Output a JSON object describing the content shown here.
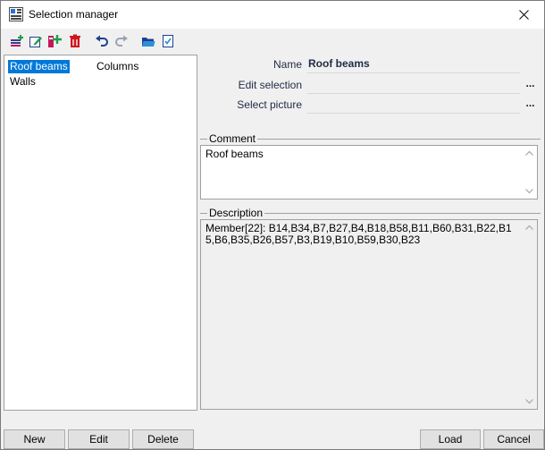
{
  "window": {
    "title": "Selection manager"
  },
  "list": {
    "items": [
      "Roof beams",
      "Columns",
      "Walls"
    ],
    "selected": "Roof beams"
  },
  "properties": {
    "name_label": "Name",
    "name_value": "Roof beams",
    "edit_selection_label": "Edit selection",
    "select_picture_label": "Select picture",
    "dots": "..."
  },
  "comment": {
    "label": "Comment",
    "text": "Roof beams"
  },
  "description": {
    "label": "Description",
    "text": "Member[22]: B14,B34,B7,B27,B4,B18,B58,B11,B60,B31,B22,B15,B6,B35,B26,B57,B3,B19,B10,B59,B30,B23"
  },
  "buttons": {
    "new": "New",
    "edit": "Edit",
    "delete": "Delete",
    "load": "Load",
    "cancel": "Cancel"
  },
  "toolbar_icons": [
    "new-selection-icon",
    "edit-selection-icon",
    "add-to-selection-icon",
    "delete-selection-icon",
    "undo-icon",
    "redo-icon",
    "open-folder-icon",
    "checklist-icon"
  ]
}
